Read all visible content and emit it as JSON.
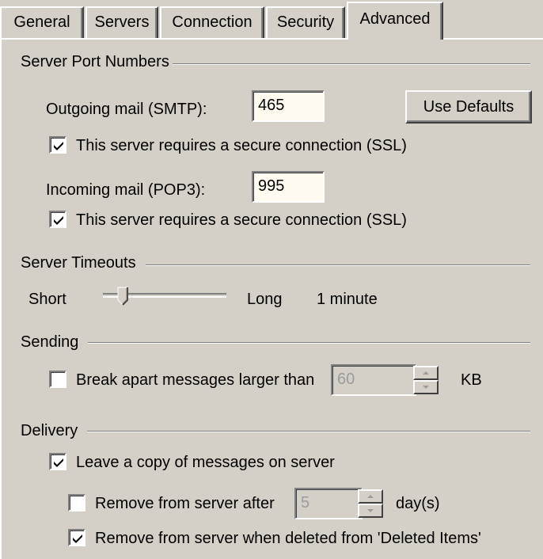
{
  "tabs": [
    {
      "label": "General",
      "active": false
    },
    {
      "label": "Servers",
      "active": false
    },
    {
      "label": "Connection",
      "active": false
    },
    {
      "label": "Security",
      "active": false
    },
    {
      "label": "Advanced",
      "active": true
    }
  ],
  "port_numbers": {
    "heading": "Server Port Numbers",
    "smtp_label": "Outgoing mail (SMTP):",
    "smtp_value": "465",
    "use_defaults": "Use Defaults",
    "smtp_ssl_label": "This server requires a secure connection (SSL)",
    "smtp_ssl_checked": true,
    "pop3_label": "Incoming mail (POP3):",
    "pop3_value": "995",
    "pop3_ssl_label": "This server requires a secure connection (SSL)",
    "pop3_ssl_checked": true
  },
  "timeouts": {
    "heading": "Server Timeouts",
    "short_label": "Short",
    "long_label": "Long",
    "value_text": "1 minute"
  },
  "sending": {
    "heading": "Sending",
    "break_apart_label": "Break apart messages larger than",
    "break_apart_checked": false,
    "size_value": "60",
    "unit": "KB"
  },
  "delivery": {
    "heading": "Delivery",
    "leave_copy_label": "Leave a copy of messages on server",
    "leave_copy_checked": true,
    "remove_after_label": "Remove from server after",
    "remove_after_checked": false,
    "days_value": "5",
    "days_unit": "day(s)",
    "remove_deleted_label": "Remove from server when deleted from 'Deleted Items'",
    "remove_deleted_checked": true
  }
}
